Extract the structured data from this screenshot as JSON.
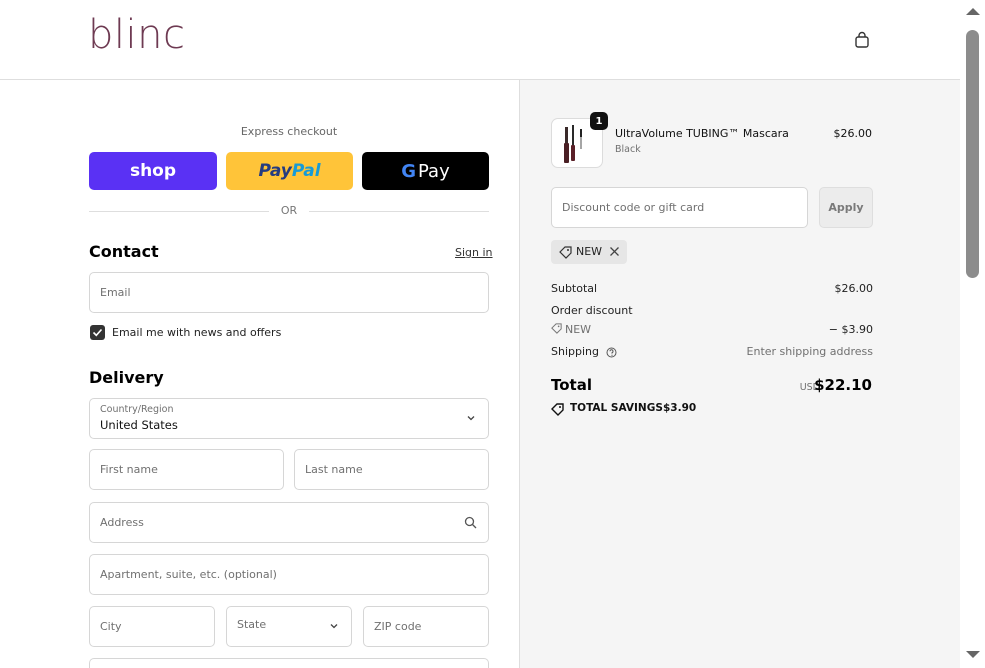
{
  "header": {
    "logo": "blinc",
    "cart_icon": "shopping-bag-icon"
  },
  "express": {
    "label": "Express checkout",
    "shop_label": "shop",
    "paypal_part1": "Pay",
    "paypal_part2": "Pal",
    "gpay_g": "G",
    "gpay_label": "Pay",
    "or_label": "OR"
  },
  "contact": {
    "title": "Contact",
    "signin_label": "Sign in",
    "email_placeholder": "Email",
    "newsletter_label": "Email me with news and offers",
    "newsletter_checked": true
  },
  "delivery": {
    "title": "Delivery",
    "country_label": "Country/Region",
    "country_value": "United States",
    "first_name_placeholder": "First name",
    "last_name_placeholder": "Last name",
    "address_placeholder": "Address",
    "apartment_placeholder": "Apartment, suite, etc. (optional)",
    "city_placeholder": "City",
    "state_label": "State",
    "zip_placeholder": "ZIP code"
  },
  "order": {
    "product": {
      "quantity": "1",
      "name": "UltraVolume TUBING™ Mascara",
      "variant": "Black",
      "price": "$26.00"
    },
    "discount_placeholder": "Discount code or gift card",
    "apply_label": "Apply",
    "applied_code": "NEW",
    "subtotal_label": "Subtotal",
    "subtotal_value": "$26.00",
    "order_discount_label": "Order discount",
    "discount_code": "NEW",
    "discount_value": "− $3.90",
    "shipping_label": "Shipping",
    "shipping_value": "Enter shipping address",
    "total_label": "Total",
    "currency": "USD",
    "total_value": "$22.10",
    "savings_label": "TOTAL SAVINGS",
    "savings_value": "$3.90"
  },
  "colors": {
    "brand": "#6e3a52",
    "shop_pay": "#5a31f4",
    "paypal": "#ffc439",
    "gpay": "#000000"
  }
}
